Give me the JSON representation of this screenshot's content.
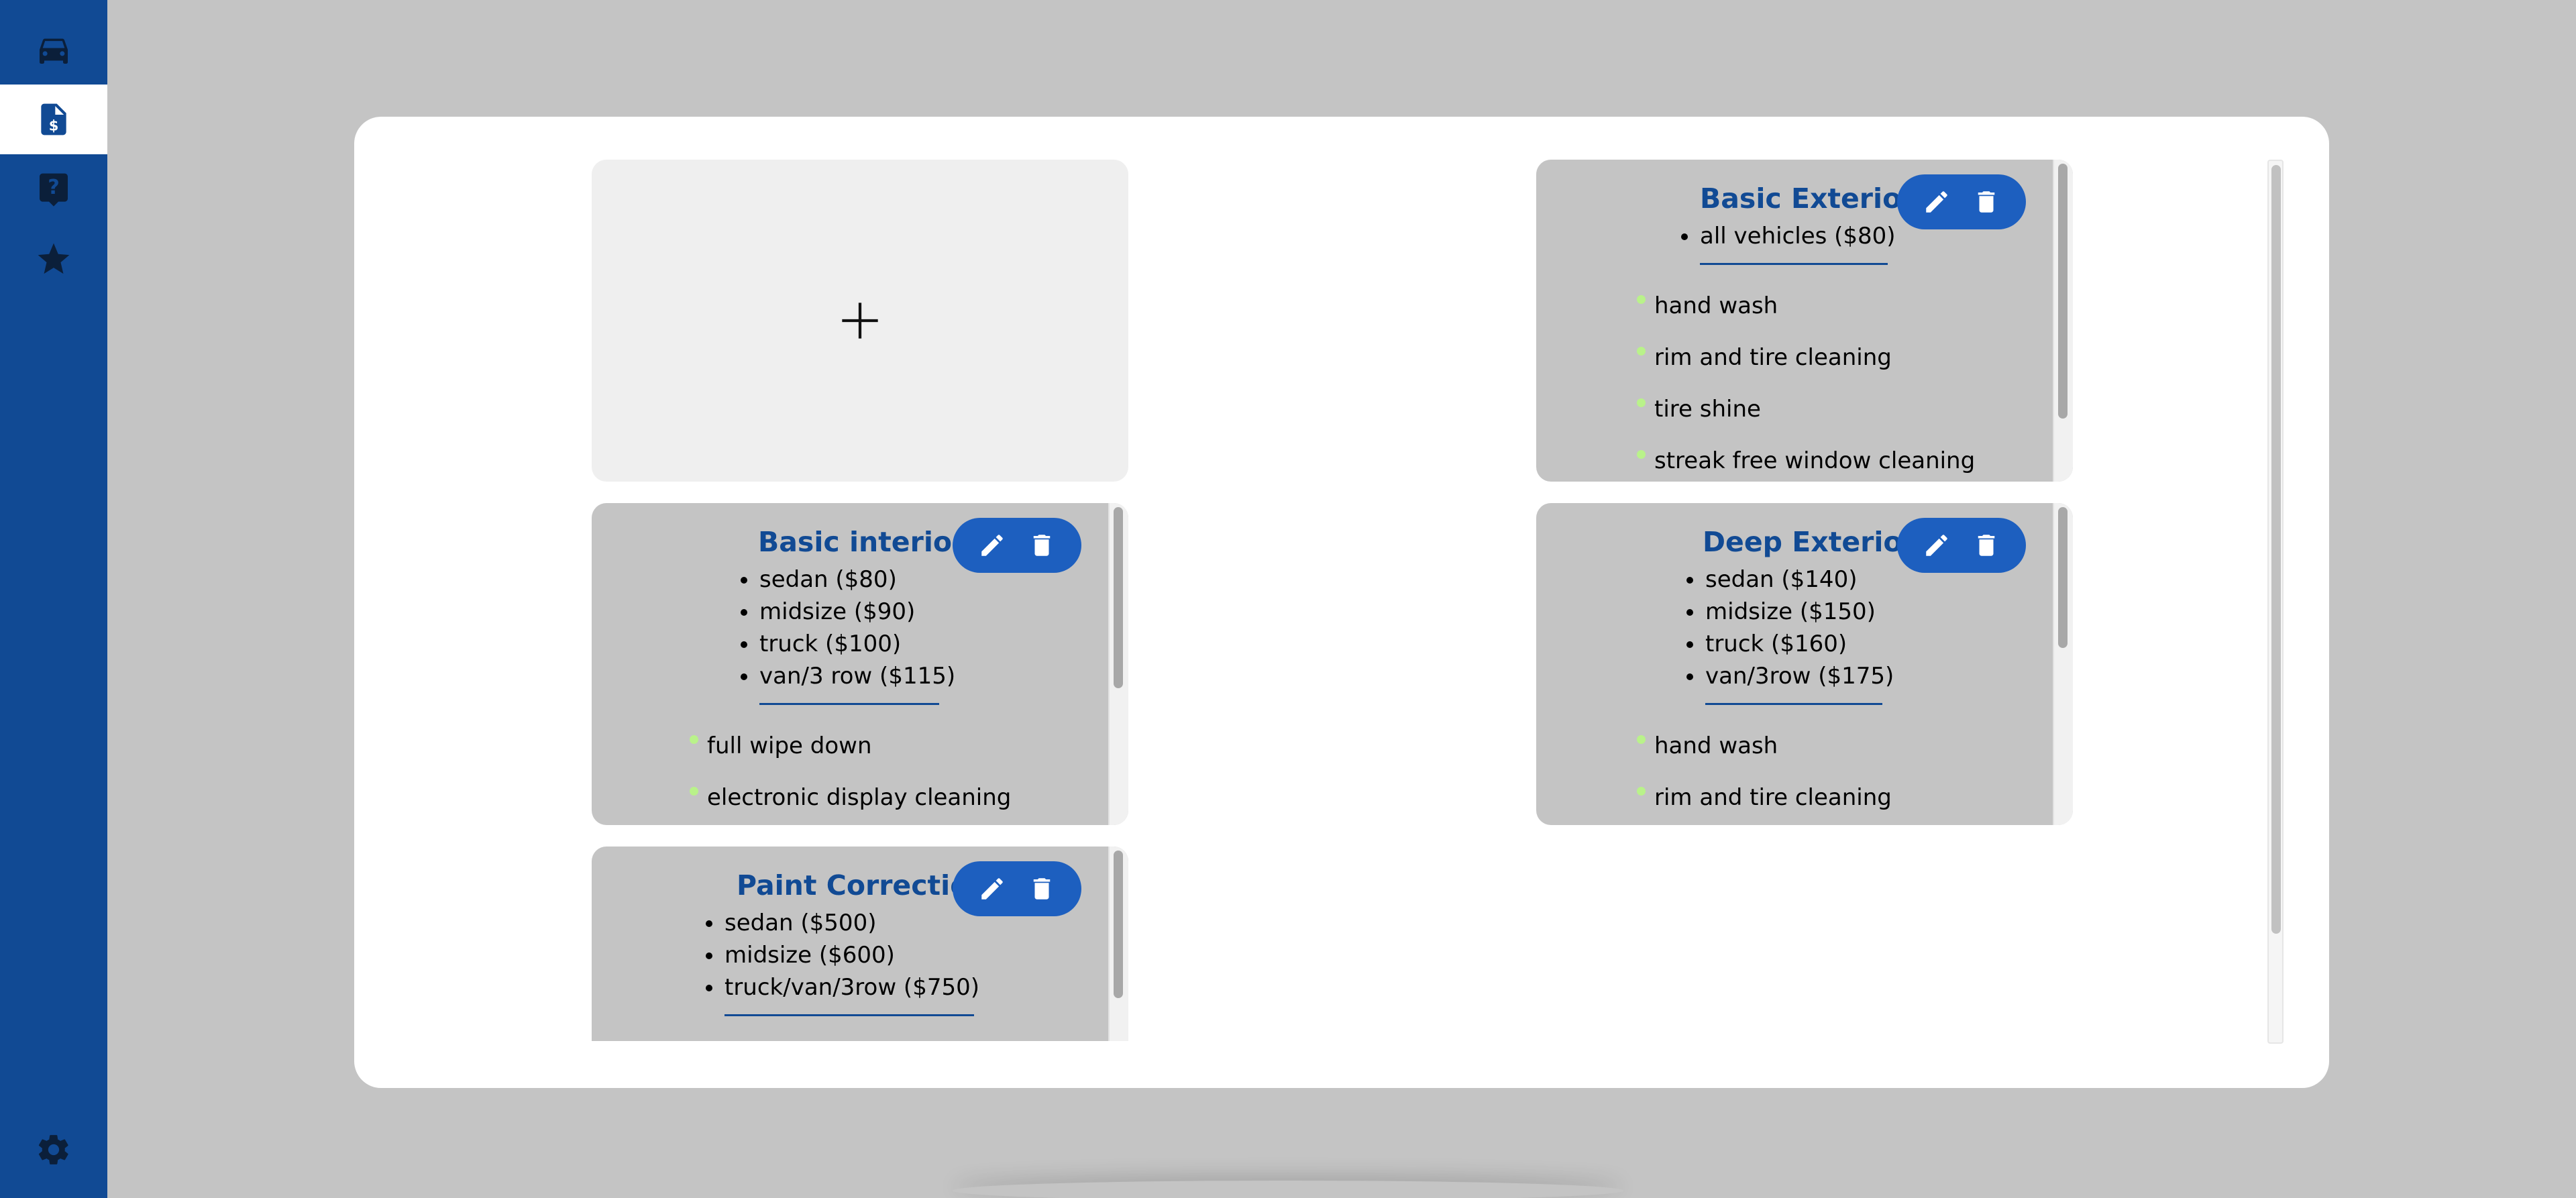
{
  "sidebar": {
    "items": [
      {
        "name": "vehicles",
        "icon": "car-icon",
        "active": false
      },
      {
        "name": "pricing",
        "icon": "price-document-icon",
        "active": true
      },
      {
        "name": "faq",
        "icon": "help-icon",
        "active": false
      },
      {
        "name": "reviews",
        "icon": "star-icon",
        "active": false
      }
    ],
    "settings_icon": "gear-icon"
  },
  "add_card": {
    "icon": "plus-icon"
  },
  "packages": [
    {
      "title": "Basic Exterior",
      "prices": [
        "all vehicles ($80)"
      ],
      "features": [
        "hand wash",
        "rim and tire cleaning",
        "tire shine",
        "streak free window cleaning"
      ]
    },
    {
      "title": "Basic interior",
      "prices": [
        "sedan ($80)",
        "midsize ($90)",
        "truck ($100)",
        "van/3 row ($115)"
      ],
      "features": [
        "full wipe down",
        "electronic display cleaning"
      ]
    },
    {
      "title": "Deep Exterior",
      "prices": [
        "sedan ($140)",
        "midsize ($150)",
        "truck ($160)",
        "van/3row ($175)"
      ],
      "features": [
        "hand wash",
        "rim and tire cleaning"
      ]
    },
    {
      "title": "Paint Correction",
      "prices": [
        "sedan ($500)",
        "midsize ($600)",
        "truck/van/3row ($750)"
      ],
      "features": []
    }
  ],
  "colors": {
    "brand": "#114a94",
    "action": "#1d5fbf",
    "card": "#c4c4c4",
    "feature_bullet": "#b9f28a"
  }
}
